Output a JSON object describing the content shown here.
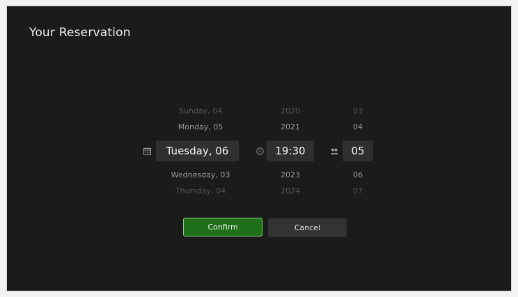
{
  "dialog": {
    "title": "Your Reservation"
  },
  "date_column": {
    "icon": "calendar-icon",
    "items": [
      "Sunday, 04",
      "Monday, 05",
      "Wednesday, 03",
      "Thursday, 04"
    ],
    "selected": "Tuesday, 06"
  },
  "time_column": {
    "icon": "clock-icon",
    "items": [
      "2020",
      "2021",
      "2023",
      "2024"
    ],
    "selected": "19:30"
  },
  "guests_column": {
    "icon": "people-icon",
    "items": [
      "03",
      "04",
      "06",
      "07"
    ],
    "selected": "05"
  },
  "actions": {
    "confirm_label": "Confirm",
    "cancel_label": "Cancel"
  },
  "colors": {
    "background": "#1b1b1b",
    "confirm_bg": "#1f6f1b",
    "confirm_border": "#8fd47e",
    "selected_bg": "#2f2f2f"
  }
}
